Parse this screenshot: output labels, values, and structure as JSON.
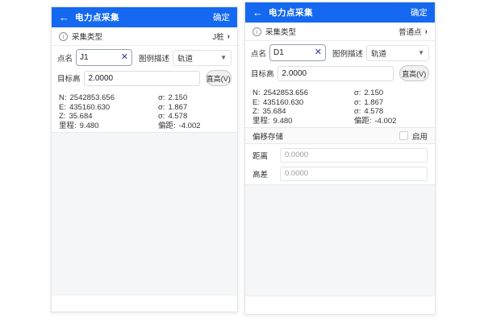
{
  "colors": {
    "header_blue": "#1569f0",
    "clear_icon_navy": "#2b3a9e"
  },
  "screens": [
    {
      "header": {
        "back_icon": "←",
        "title": "电力点采集",
        "action": "确定"
      },
      "type_row": {
        "info_icon": "i",
        "label": "采集类型",
        "value": "J桩",
        "chevron": "›"
      },
      "form": {
        "point_name_label": "点名",
        "point_name_value": "J1",
        "clear_icon": "✕",
        "legend_label": "图例描述",
        "legend_value": "轨道",
        "caret_icon": "▼",
        "target_height_label": "目标高",
        "target_height_value": "2.0000",
        "height_button": "直高(V)"
      },
      "coords": [
        {
          "label": "N:",
          "value": "2542853.656",
          "slabel": "σ:",
          "svalue": "2.150"
        },
        {
          "label": "E:",
          "value": "435160.630",
          "slabel": "σ:",
          "svalue": "1.867"
        },
        {
          "label": "Z:",
          "value": "35.684",
          "slabel": "σ:",
          "svalue": "4.578"
        },
        {
          "label": "里程:",
          "value": "9.480",
          "slabel": "偏距:",
          "svalue": "-4.002"
        }
      ]
    },
    {
      "header": {
        "back_icon": "←",
        "title": "电力点采集",
        "action": "确定"
      },
      "type_row": {
        "info_icon": "i",
        "label": "采集类型",
        "value": "普通点",
        "chevron": "›"
      },
      "form": {
        "point_name_label": "点名",
        "point_name_value": "D1",
        "clear_icon": "✕",
        "legend_label": "图例描述",
        "legend_value": "轨道",
        "caret_icon": "▼",
        "target_height_label": "目标高",
        "target_height_value": "2.0000",
        "height_button": "直高(V)"
      },
      "coords": [
        {
          "label": "N:",
          "value": "2542853.656",
          "slabel": "σ:",
          "svalue": "2.150"
        },
        {
          "label": "E:",
          "value": "435160.630",
          "slabel": "σ:",
          "svalue": "1.867"
        },
        {
          "label": "Z:",
          "value": "35.684",
          "slabel": "σ:",
          "svalue": "4.578"
        },
        {
          "label": "里程:",
          "value": "9.480",
          "slabel": "偏距:",
          "svalue": "-4.002"
        }
      ],
      "offset_section": {
        "title": "偏移存储",
        "enable_label": "启用",
        "rows": [
          {
            "label": "距离",
            "value": "0.0000"
          },
          {
            "label": "高差",
            "value": "0.0000"
          }
        ]
      }
    }
  ]
}
